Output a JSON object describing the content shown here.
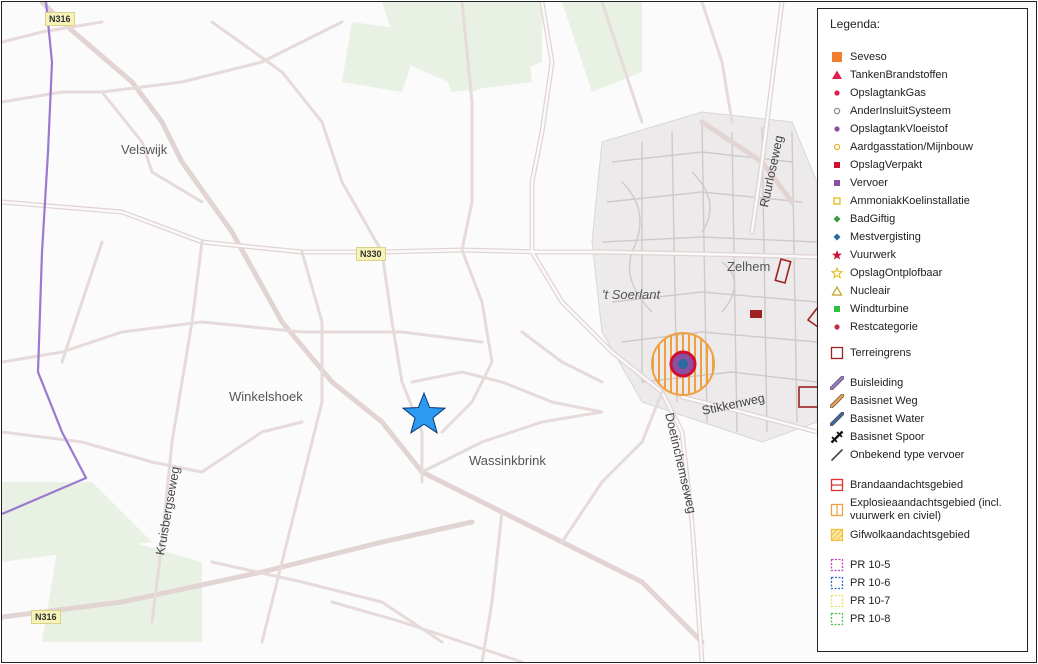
{
  "map": {
    "place_labels": [
      {
        "id": "velswijk",
        "text": "Velswijk"
      },
      {
        "id": "winkelshoek",
        "text": "Winkelshoek"
      },
      {
        "id": "wassinkbrink",
        "text": "Wassinkbrink"
      },
      {
        "id": "zelhem",
        "text": "Zelhem"
      },
      {
        "id": "soerlant",
        "text": "'t Soerlant"
      }
    ],
    "road_shields": [
      {
        "id": "n316-top",
        "text": "N316"
      },
      {
        "id": "n330",
        "text": "N330"
      },
      {
        "id": "n316-bottom",
        "text": "N316"
      }
    ],
    "street_labels": [
      {
        "id": "ruurloseweg",
        "text": "Ruurloseweg"
      },
      {
        "id": "stikkenweg",
        "text": "Stikkenweg"
      },
      {
        "id": "doetinchemseweg",
        "text": "Doetinchemseweg"
      },
      {
        "id": "kruisbergseweg",
        "text": "Kruisbergseweg"
      }
    ],
    "location_marker": {
      "icon": "star-icon",
      "color": "#2b9af0"
    }
  },
  "legend": {
    "title": "Legenda:",
    "groups": [
      [
        {
          "label": "Seveso",
          "symbol": "square",
          "color": "#f08030"
        },
        {
          "label": "TankenBrandstoffen",
          "symbol": "triangle",
          "color": "#e0204a"
        },
        {
          "label": "OpslagtankGas",
          "symbol": "dot",
          "color": "#e0204a"
        },
        {
          "label": "AnderInsluitSysteem",
          "symbol": "ring",
          "color": "#888888"
        },
        {
          "label": "OpslagtankVloeistof",
          "symbol": "dot",
          "color": "#8a4fa0"
        },
        {
          "label": "Aardgasstation/Mijnbouw",
          "symbol": "ring",
          "color": "#e0b020"
        },
        {
          "label": "OpslagVerpakt",
          "symbol": "smallsquare",
          "color": "#d01030"
        },
        {
          "label": "Vervoer",
          "symbol": "smallsquare",
          "color": "#8a4fa0"
        },
        {
          "label": "AmmoniakKoelinstallatie",
          "symbol": "squareoutline",
          "color": "#e0c020"
        },
        {
          "label": "BadGiftig",
          "symbol": "diamond",
          "color": "#3a9a40"
        },
        {
          "label": "Mestvergisting",
          "symbol": "diamond",
          "color": "#2a6aa0"
        },
        {
          "label": "Vuurwerk",
          "symbol": "star",
          "color": "#d01030"
        },
        {
          "label": "OpslagOntplofbaar",
          "symbol": "staroutline",
          "color": "#e0c020"
        },
        {
          "label": "Nucleair",
          "symbol": "triangleoutline",
          "color": "#c0a020"
        },
        {
          "label": "Windturbine",
          "symbol": "smallsquare",
          "color": "#30c040"
        },
        {
          "label": "Restcategorie",
          "symbol": "dot",
          "color": "#c03040"
        }
      ],
      [
        {
          "label": "Terreingrens",
          "symbol": "squareoutline-lg",
          "color": "#a02020"
        }
      ],
      [
        {
          "label": "Buisleiding",
          "symbol": "pipe",
          "color": "#9a7ad0"
        },
        {
          "label": "Basisnet Weg",
          "symbol": "pipe",
          "color": "#f0a040"
        },
        {
          "label": "Basisnet Water",
          "symbol": "pipe",
          "color": "#3a6aa0"
        },
        {
          "label": "Basisnet Spoor",
          "symbol": "rail",
          "color": "#111111"
        },
        {
          "label": "Onbekend type vervoer",
          "symbol": "line",
          "color": "#444444"
        }
      ],
      [
        {
          "label": "Brandaandachtsgebied",
          "symbol": "hatch-h",
          "color": "#e03030"
        },
        {
          "label": "Explosieaandachtsgebied (incl. vuurwerk en civiel)",
          "symbol": "hatch-v",
          "color": "#f0a040"
        },
        {
          "label": "Gifwolkaandachtsgebied",
          "symbol": "hatch-d",
          "color": "#f0c040"
        }
      ],
      [
        {
          "label": "PR 10-5",
          "symbol": "dashed",
          "color": "#c040c0"
        },
        {
          "label": "PR 10-6",
          "symbol": "dashed",
          "color": "#2a70c0"
        },
        {
          "label": "PR 10-7",
          "symbol": "dashed",
          "color": "#e8e060"
        },
        {
          "label": "PR 10-8",
          "symbol": "dashed",
          "color": "#50c050"
        }
      ]
    ]
  }
}
